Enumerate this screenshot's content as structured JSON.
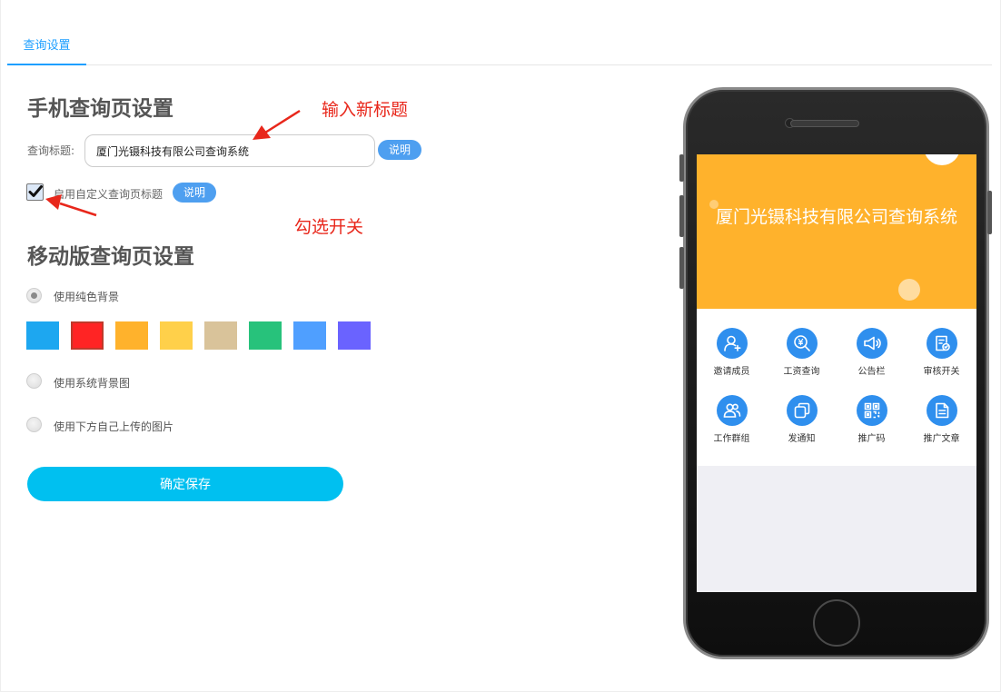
{
  "tabs": [
    {
      "label": "查询设置"
    }
  ],
  "section_mobile": {
    "heading": "手机查询页设置",
    "title_label": "查询标题:",
    "title_value": "厦门光镊科技有限公司查询系统",
    "help_label": "说明",
    "custom_title_checkbox": {
      "label": "启用自定义查询页标题",
      "checked": true
    }
  },
  "section_mobile_page": {
    "heading": "移动版查询页设置",
    "options": [
      {
        "label": "使用纯色背景",
        "checked": true
      },
      {
        "label": "使用系统背景图",
        "checked": false
      },
      {
        "label": "使用下方自己上传的图片",
        "checked": false
      }
    ],
    "swatches": [
      "#1da7f0",
      "#ff2424",
      "#ffb22c",
      "#ffd04a",
      "#d9c39a",
      "#27c27b",
      "#4f9fff",
      "#6a63ff"
    ],
    "selected_swatch": 1
  },
  "save_label": "确定保存",
  "annotations": {
    "input_hint": "输入新标题",
    "check_hint": "勾选开关"
  },
  "preview": {
    "banner_title": "厦门光镊科技有限公司查询系统",
    "banner_color": "#ffb22c",
    "icon_color": "#2f8fee",
    "grid": [
      {
        "label": "邀请成员",
        "icon": "add-user-icon"
      },
      {
        "label": "工资查询",
        "icon": "salary-search-icon"
      },
      {
        "label": "公告栏",
        "icon": "megaphone-icon"
      },
      {
        "label": "审核开关",
        "icon": "review-document-icon"
      },
      {
        "label": "工作群组",
        "icon": "group-icon"
      },
      {
        "label": "发通知",
        "icon": "notification-copy-icon"
      },
      {
        "label": "推广码",
        "icon": "qr-code-icon"
      },
      {
        "label": "推广文章",
        "icon": "article-icon"
      }
    ]
  }
}
